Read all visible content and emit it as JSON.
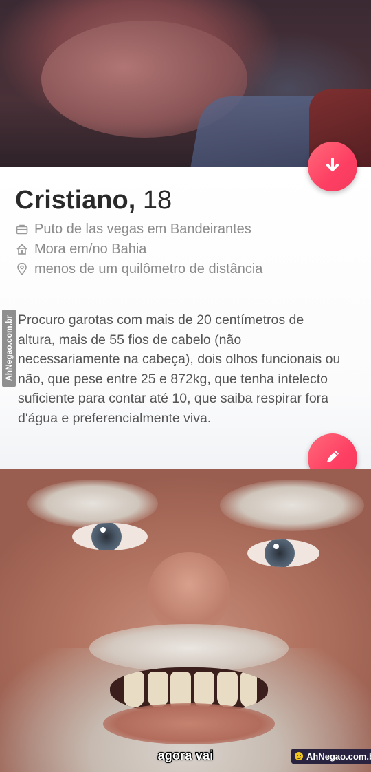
{
  "profile": {
    "name": "Cristiano,",
    "age": "18",
    "job": "Puto de las vegas em Bandeirantes",
    "lives_in": "Mora em/no Bahia",
    "distance": "menos de um quilômetro de distância",
    "bio": "Procuro garotas com mais de 20 centímetros de altura, mais de 55 fios de cabelo (não necessariamente na cabeça), dois olhos funcionais ou não, que pese entre 25 e 872kg, que tenha intelecto suficiente para contar até 10, que saiba respirar fora d'água e preferencialmente viva."
  },
  "icons": {
    "job": "briefcase-icon",
    "lives_in": "house-icon",
    "distance": "location-pin-icon",
    "collapse_button": "arrow-down-icon",
    "edit_button": "pencil-icon"
  },
  "meme": {
    "caption": "agora vai"
  },
  "watermark": {
    "side_text": "AhNegao.com.br",
    "badge_text": "AhNegao.com.br"
  },
  "colors": {
    "accent": "#fd3f63",
    "name_text": "#2a2a2a",
    "detail_text": "#8b8b8b",
    "bio_text": "#555555"
  }
}
